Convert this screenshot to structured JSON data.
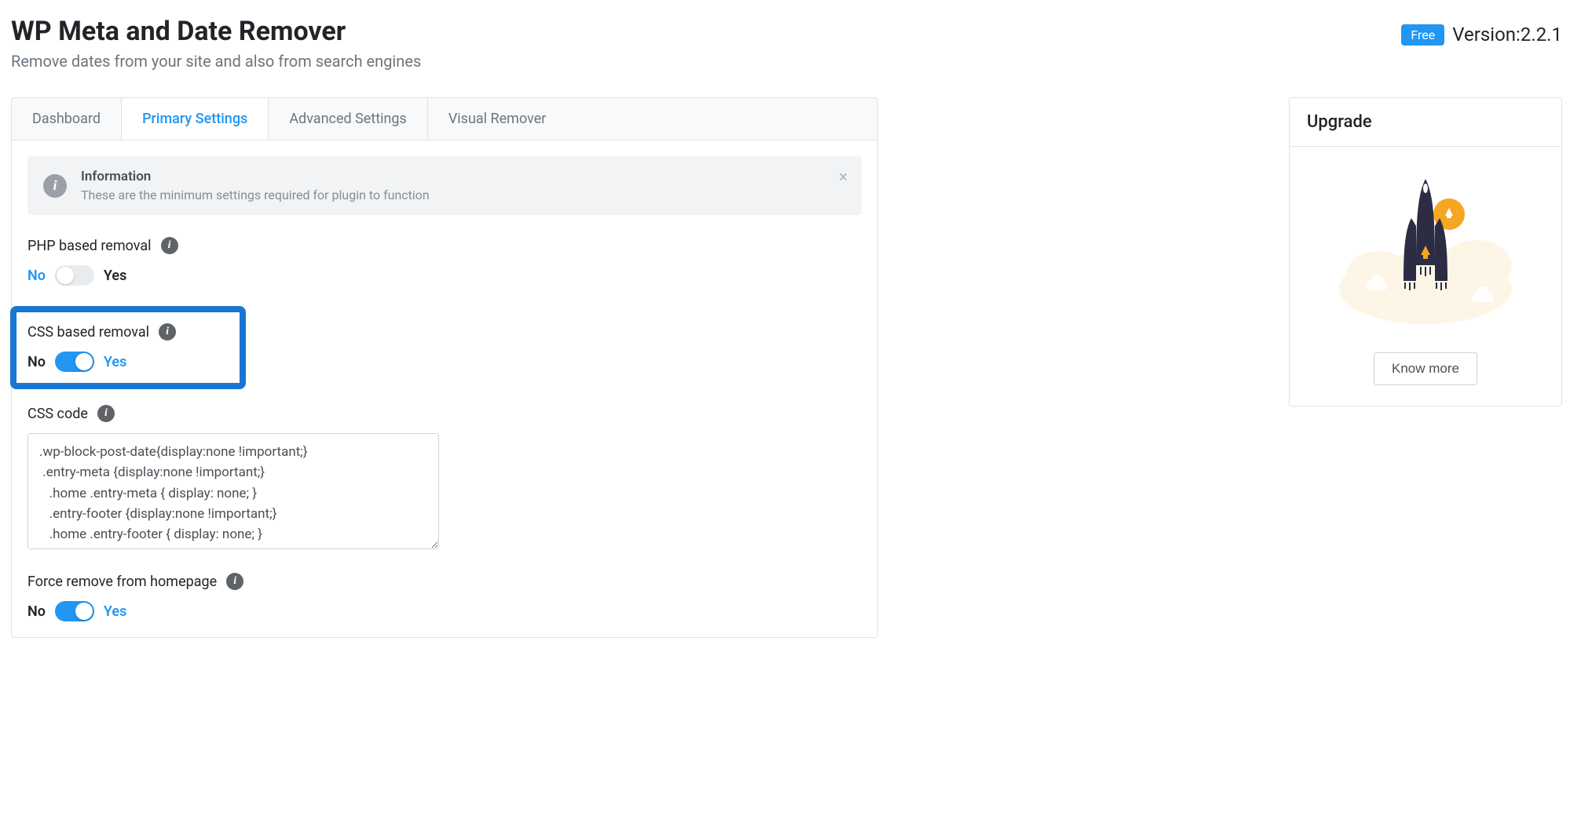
{
  "header": {
    "title": "WP Meta and Date Remover",
    "subtitle": "Remove dates from your site and also from search engines",
    "badge": "Free",
    "version_label": "Version:",
    "version_value": "2.2.1"
  },
  "tabs": [
    {
      "label": "Dashboard",
      "active": false
    },
    {
      "label": "Primary Settings",
      "active": true
    },
    {
      "label": "Advanced Settings",
      "active": false
    },
    {
      "label": "Visual Remover",
      "active": false
    }
  ],
  "info": {
    "title": "Information",
    "desc": "These are the minimum settings required for plugin to function"
  },
  "settings": {
    "php_removal": {
      "label": "PHP based removal",
      "no": "No",
      "yes": "Yes",
      "state": "off"
    },
    "css_removal": {
      "label": "CSS based removal",
      "no": "No",
      "yes": "Yes",
      "state": "on"
    },
    "css_code": {
      "label": "CSS code",
      "value": ".wp-block-post-date{display:none !important;}\n .entry-meta {display:none !important;}\n   .home .entry-meta { display: none; }\n   .entry-footer {display:none !important;}\n   .home .entry-footer { display: none; }"
    },
    "force_home": {
      "label": "Force remove from homepage",
      "no": "No",
      "yes": "Yes",
      "state": "on"
    }
  },
  "sidebar": {
    "upgrade_title": "Upgrade",
    "know_more": "Know more"
  }
}
